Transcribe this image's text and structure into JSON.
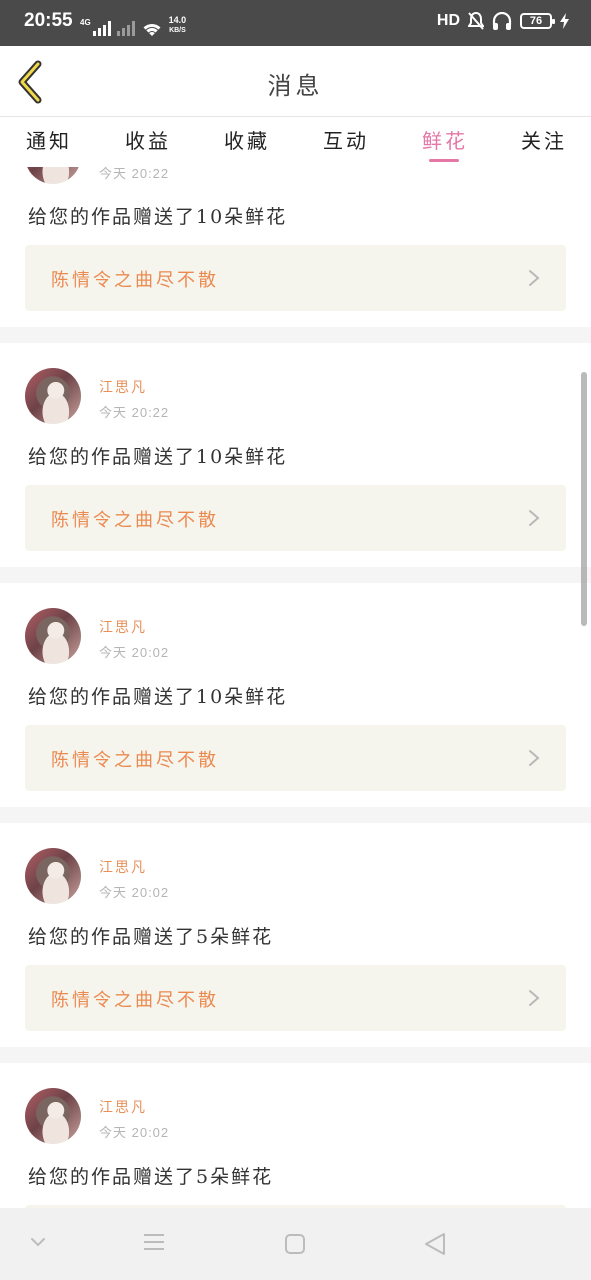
{
  "status_bar": {
    "time": "20:55",
    "network_type": "4G",
    "net_speed_value": "14.0",
    "net_speed_unit": "KB/S",
    "hd_label": "HD",
    "battery": "76"
  },
  "header": {
    "title": "消息",
    "back_icon": "chevron-left-icon"
  },
  "tabs": [
    {
      "label": "通知",
      "active": false
    },
    {
      "label": "收益",
      "active": false
    },
    {
      "label": "收藏",
      "active": false
    },
    {
      "label": "互动",
      "active": false
    },
    {
      "label": "鲜花",
      "active": true
    },
    {
      "label": "关注",
      "active": false
    }
  ],
  "accent_color": "#e477a6",
  "name_color": "#e8905a",
  "partial_top_item": {
    "timestamp": "今天 20:22",
    "message": "给您的作品赠送了10朵鲜花",
    "work_title": "陈情令之曲尽不散"
  },
  "items": [
    {
      "username": "江思凡",
      "timestamp": "今天 20:22",
      "message": "给您的作品赠送了10朵鲜花",
      "work_title": "陈情令之曲尽不散"
    },
    {
      "username": "江思凡",
      "timestamp": "今天 20:02",
      "message": "给您的作品赠送了10朵鲜花",
      "work_title": "陈情令之曲尽不散"
    },
    {
      "username": "江思凡",
      "timestamp": "今天 20:02",
      "message": "给您的作品赠送了5朵鲜花",
      "work_title": "陈情令之曲尽不散"
    },
    {
      "username": "江思凡",
      "timestamp": "今天 20:02",
      "message": "给您的作品赠送了5朵鲜花",
      "work_title": ""
    }
  ],
  "nav_bar": {
    "icons": [
      "chevron-down-icon",
      "menu-icon",
      "home-square-icon",
      "back-triangle-icon"
    ]
  }
}
